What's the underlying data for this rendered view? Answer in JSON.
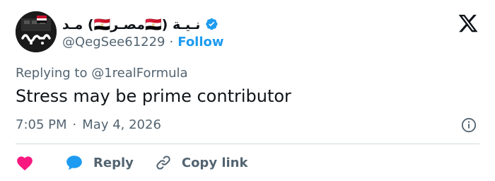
{
  "author": {
    "display_name": "مـد (🇪🇬مصـر🇪🇬) نـيـة",
    "handle": "@QegSee61229",
    "separator": "·",
    "follow_label": "Follow",
    "avatar_icon": "avatar-logo-icon",
    "verified_icon": "verified-badge-icon"
  },
  "reply_context": {
    "prefix": "Replying to",
    "mention": "@1realFormula"
  },
  "tweet": {
    "text": "Stress may be prime contributor",
    "time": "7:05 PM",
    "separator": "·",
    "date": "May 4, 2026"
  },
  "actions": {
    "like_icon": "heart-icon",
    "reply_label": "Reply",
    "copy_link_label": "Copy link"
  },
  "colors": {
    "accent": "#1d9bf0",
    "heart": "#f91880",
    "secondary_text": "#536471",
    "primary_text": "#0f1419",
    "divider": "#cfd9de"
  }
}
